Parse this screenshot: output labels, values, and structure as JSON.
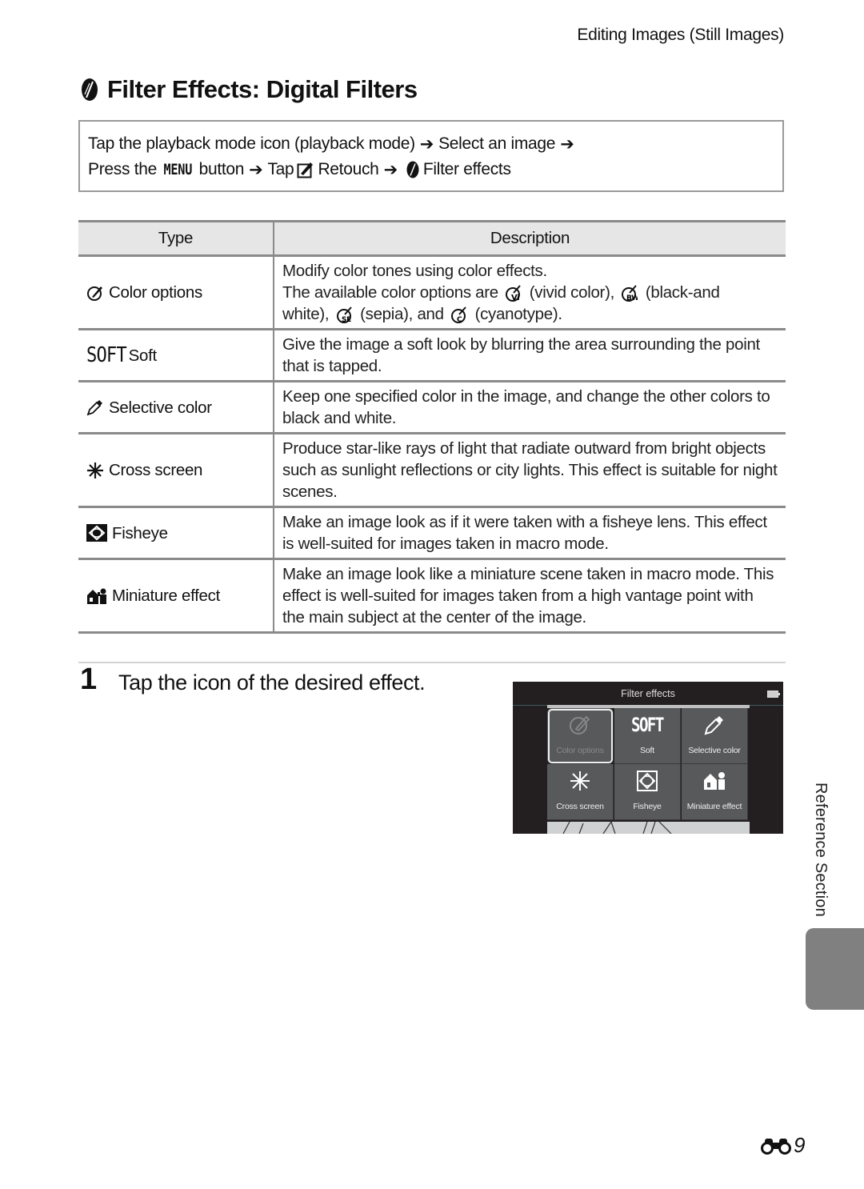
{
  "header": {
    "running_head": "Editing Images (Still Images)",
    "title": "Filter Effects: Digital Filters",
    "title_icon": "filter-effects-icon"
  },
  "navigation_box": {
    "line1": {
      "part1": "Tap the playback mode icon (playback mode)",
      "arrow": "➔",
      "part2": "Select an image"
    },
    "line2": {
      "press": "Press the",
      "menu": "MENU",
      "button": "button",
      "tap": "Tap",
      "retouch_icon": "retouch-icon",
      "retouch": "Retouch",
      "filter_icon": "filter-effects-icon",
      "filter_effects": "Filter effects"
    }
  },
  "table": {
    "headers": {
      "type": "Type",
      "description": "Description"
    },
    "rows": [
      {
        "icon": "color-options-icon",
        "type": "Color options",
        "desc_lines": [
          "Modify color tones using color effects."
        ],
        "desc_rich": {
          "prefix": "The available color options are",
          "vivid": "(vivid color),",
          "bw": "(black-and",
          "white": "white),",
          "sepia": "(sepia), and",
          "cyan": "(cyanotype)."
        }
      },
      {
        "icon": "soft-icon",
        "icon_text": "SOFT",
        "type": "Soft",
        "description": "Give the image a soft look by blurring the area surrounding the point that is tapped."
      },
      {
        "icon": "selective-color-icon",
        "type": "Selective color",
        "description": "Keep one specified color in the image, and change the other colors to black and white."
      },
      {
        "icon": "cross-screen-icon",
        "type": "Cross screen",
        "description": "Produce star-like rays of light that radiate outward from bright objects such as sunlight reflections or city lights. This effect is suitable for night scenes."
      },
      {
        "icon": "fisheye-icon",
        "type": "Fisheye",
        "description": "Make an image look as if it were taken with a fisheye lens. This effect is well-suited for images taken in macro mode."
      },
      {
        "icon": "miniature-effect-icon",
        "type": "Miniature effect",
        "description": "Make an image look like a miniature scene taken in macro mode. This effect is well-suited for images taken from a high vantage point with the main subject at the center of the image."
      }
    ]
  },
  "step": {
    "number": "1",
    "text": "Tap the icon of the desired effect."
  },
  "camera_screen": {
    "title": "Filter effects",
    "tiles": [
      {
        "label": "Color options",
        "icon": "color-options-icon",
        "selected": true
      },
      {
        "label": "Soft",
        "icon_text": "SOFT",
        "icon": "soft-icon"
      },
      {
        "label": "Selective color",
        "icon": "selective-color-icon"
      },
      {
        "label": "Cross screen",
        "icon": "cross-screen-icon"
      },
      {
        "label": "Fisheye",
        "icon": "fisheye-icon"
      },
      {
        "label": "Miniature effect",
        "icon": "miniature-effect-icon"
      }
    ]
  },
  "side": {
    "section_label": "Reference Section"
  },
  "footer": {
    "page_prefix_icon": "reference-binoculars-icon",
    "page_number": "9"
  }
}
